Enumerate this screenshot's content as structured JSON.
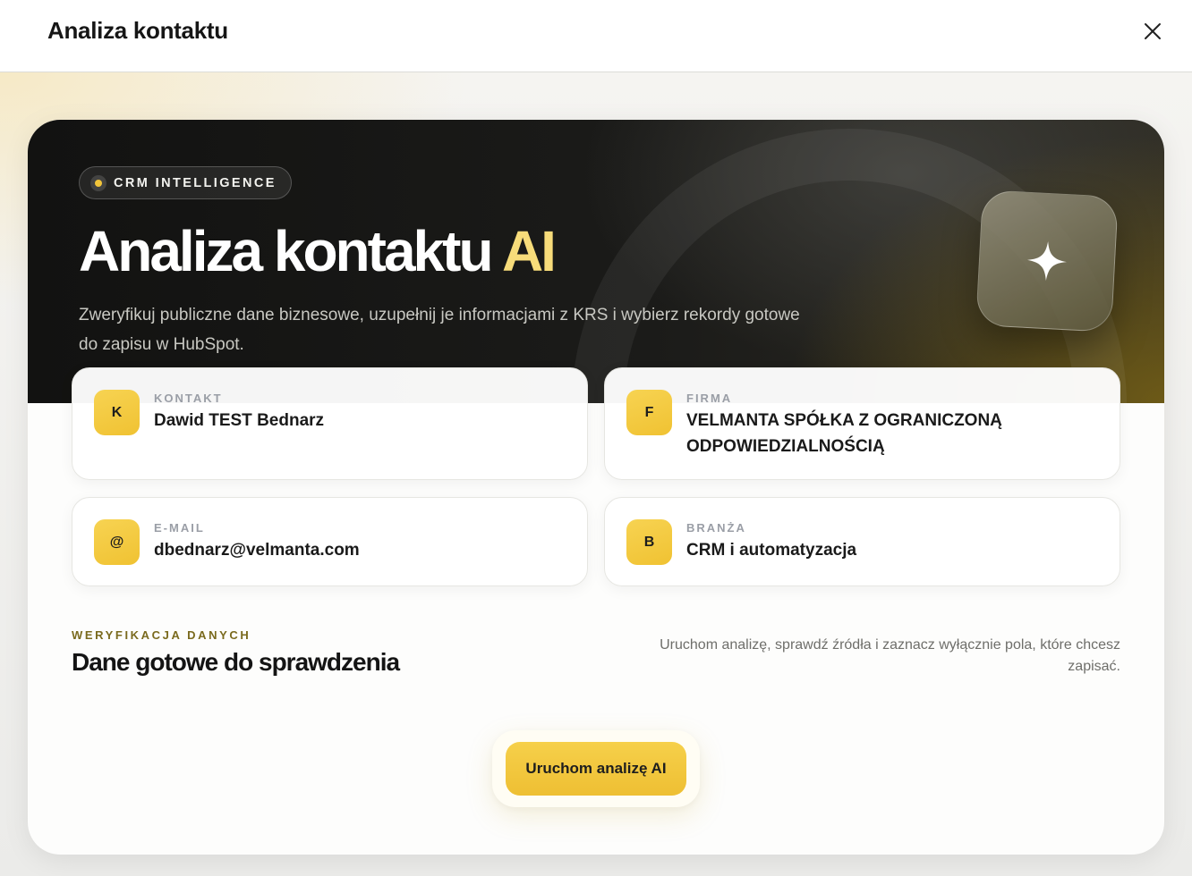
{
  "header": {
    "title": "Analiza kontaktu",
    "close_icon": "close-icon"
  },
  "hero": {
    "pill_label": "CRM INTELLIGENCE",
    "title_main": "Analiza kontaktu",
    "title_accent": "AI",
    "description": "Zweryfikuj publiczne dane biznesowe, uzupełnij je informacjami z KRS i wybierz rekordy gotowe do zapisu w HubSpot.",
    "icon": "sparkle-icon",
    "accent_color": "#f7dc7a"
  },
  "fields": [
    {
      "badge": "K",
      "label": "KONTAKT",
      "value": "Dawid TEST Bednarz"
    },
    {
      "badge": "F",
      "label": "FIRMA",
      "value": "VELMANTA SPÓŁKA Z OGRANICZONĄ ODPOWIEDZIALNOŚCIĄ"
    },
    {
      "badge": "@",
      "label": "E-MAIL",
      "value": "dbednarz@velmanta.com"
    },
    {
      "badge": "B",
      "label": "BRANŻA",
      "value": "CRM i automatyzacja"
    }
  ],
  "verification": {
    "eyebrow": "WERYFIKACJA DANYCH",
    "title": "Dane gotowe do sprawdzenia",
    "hint": "Uruchom analizę, sprawdź źródła i zaznacz wyłącznie pola, które chcesz zapisać."
  },
  "cta": {
    "label": "Uruchom analizę AI",
    "color": "#f2c63c"
  }
}
